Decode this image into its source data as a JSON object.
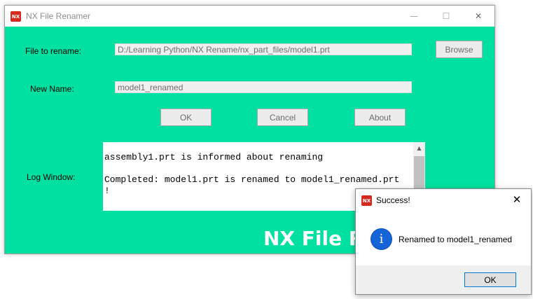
{
  "colors": {
    "accent": "#00e0a0",
    "app_icon": "#d42a1f",
    "info_icon": "#1565d8"
  },
  "window": {
    "title": "NX File Renamer",
    "icon_text": "NX",
    "minimize_glyph": "—",
    "maximize_glyph": "☐",
    "close_glyph": "✕"
  },
  "form": {
    "file_label": "File to rename:",
    "file_value": "D:/Learning Python/NX Rename/nx_part_files/model1.prt",
    "browse_label": "Browse",
    "newname_label": "New Name:",
    "newname_value": "model1_renamed",
    "ok_label": "OK",
    "cancel_label": "Cancel",
    "about_label": "About",
    "log_label": "Log Window:",
    "log_text": "assembly1.prt is informed about renaming\n\nCompleted: model1.prt is renamed to model1_renamed.prt\n!",
    "scroll_up_glyph": "▲",
    "scroll_down_glyph": "▼"
  },
  "banner": {
    "text": "NX File Renamer"
  },
  "dialog": {
    "title": "Success!",
    "icon_text": "NX",
    "close_glyph": "✕",
    "info_glyph": "i",
    "message": "Renamed to model1_renamed",
    "ok_label": "OK"
  }
}
